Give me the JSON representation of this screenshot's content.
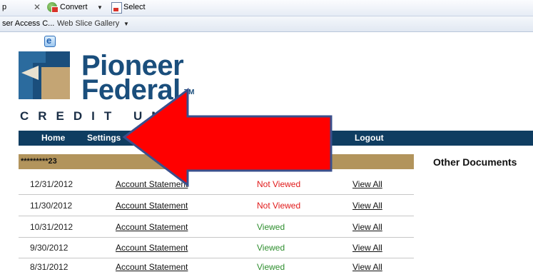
{
  "toolbar": {
    "left_fragment": "p",
    "convert_label": "Convert",
    "select_label": "Select",
    "favorites_fragment": "ser Access C...",
    "web_slice_label": "Web Slice Gallery"
  },
  "logo": {
    "line1": "Pioneer",
    "line2": "Federal",
    "tm": "TM",
    "tagline": "CREDIT UN"
  },
  "nav": {
    "home": "Home",
    "settings": "Settings",
    "logout": "Logout"
  },
  "account": {
    "number": "*********23",
    "other_documents": "Other Documents"
  },
  "statements": [
    {
      "date": "12/31/2012",
      "title": "Account Statement",
      "status": "Not Viewed",
      "action": "View All"
    },
    {
      "date": "11/30/2012",
      "title": "Account Statement",
      "status": "Not Viewed",
      "action": "View All"
    },
    {
      "date": "10/31/2012",
      "title": "Account Statement",
      "status": "Viewed",
      "action": "View All"
    },
    {
      "date": "9/30/2012",
      "title": "Account Statement",
      "status": "Viewed",
      "action": "View All"
    },
    {
      "date": "8/31/2012",
      "title": "Account Statement",
      "status": "Viewed",
      "action": "View All"
    }
  ],
  "colors": {
    "brand_blue": "#1a4e7c",
    "nav_bg": "#0f3d61",
    "account_bar": "#b2945c",
    "not_viewed": "#e11a1a",
    "viewed": "#2f8f2f",
    "arrow": "#ff0000"
  },
  "icons": {
    "toolbar_close": "close-icon",
    "convert": "convert-pdf-icon",
    "select": "select-pdf-icon",
    "web_slice": "web-slice-icon",
    "annotation": "red-arrow-annotation"
  }
}
